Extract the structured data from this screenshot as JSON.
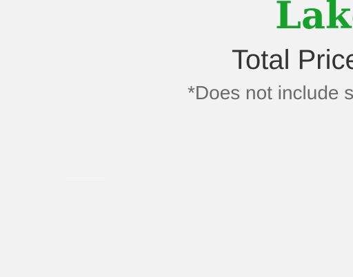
{
  "page": {
    "heading": "Lake",
    "price_label": "Total Price",
    "note": "*Does not include s"
  },
  "colors": {
    "background": "#f2f2f2",
    "heading": "#16a22a",
    "price": "#333333",
    "note": "#6a6a6a"
  }
}
